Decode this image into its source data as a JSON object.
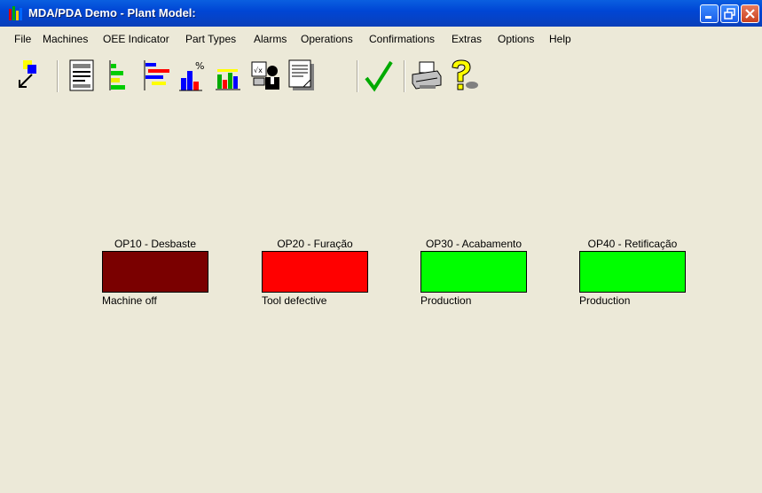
{
  "window": {
    "title": "MDA/PDA Demo - Plant Model:"
  },
  "menu": [
    "File",
    "Machines",
    "OEE Indicator",
    "Part Types",
    "Alarms",
    "Operations",
    "Confirmations",
    "Extras",
    "Options",
    "Help"
  ],
  "toolbar": {
    "buttons": [
      "exit-icon",
      "machine-data-icon",
      "gantt-bars-icon",
      "timeline-bars-icon",
      "percent-chart-icon",
      "bar-chart-icon",
      "operator-icon",
      "document-icon",
      "checkmark-icon",
      "printer-icon",
      "help-icon"
    ]
  },
  "machines": [
    {
      "label": "OP10 - Desbaste",
      "status": "Machine off",
      "color": "#7a0000"
    },
    {
      "label": "OP20 - Furação",
      "status": "Tool defective",
      "color": "#ff0000"
    },
    {
      "label": "OP30 - Acabamento",
      "status": "Production",
      "color": "#00ff00"
    },
    {
      "label": "OP40 - Retificação",
      "status": "Production",
      "color": "#00ff00"
    }
  ]
}
